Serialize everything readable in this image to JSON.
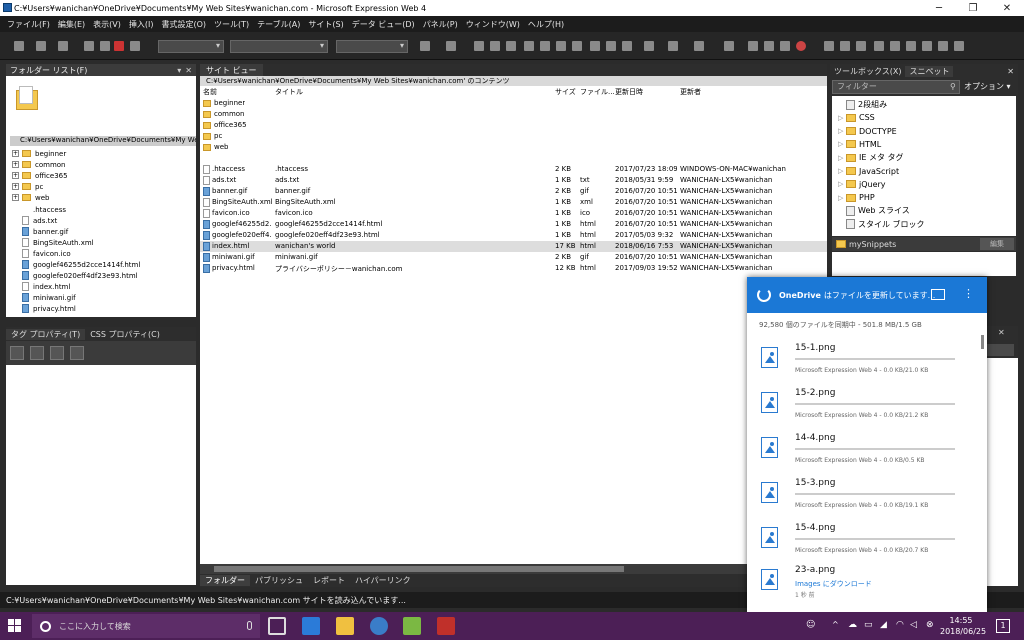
{
  "window": {
    "title": "C:¥Users¥wanichan¥OneDrive¥Documents¥My Web Sites¥wanichan.com - Microsoft Expression Web 4",
    "controls": [
      "─",
      "❐",
      "✕"
    ]
  },
  "menu": [
    "ファイル(F)",
    "編集(E)",
    "表示(V)",
    "挿入(I)",
    "書式設定(O)",
    "ツール(T)",
    "テーブル(A)",
    "サイト(S)",
    "データ ビュー(D)",
    "パネル(P)",
    "ウィンドウ(W)",
    "ヘルプ(H)"
  ],
  "folder_list": {
    "title": "フォルダー リスト(F)",
    "path": "C:¥Users¥wanichan¥OneDrive¥Documents¥My Web S",
    "folders": [
      "beginner",
      "common",
      "office365",
      "pc",
      "web"
    ],
    "files": [
      ".htaccess",
      "ads.txt",
      "banner.gif",
      "BingSiteAuth.xml",
      "favicon.ico",
      "googlef46255d2cce1414f.html",
      "googlefe020eff4df23e93.html",
      "index.html",
      "miniwani.gif",
      "privacy.html"
    ]
  },
  "tag_panel": {
    "tab1": "タグ プロパティ(T)",
    "tab2": "CSS プロパティ(C)"
  },
  "site_view": {
    "tab": "サイト ビュー",
    "path": "C:¥Users¥wanichan¥OneDrive¥Documents¥My Web Sites¥wanichan.com' のコンテンツ",
    "columns": {
      "name": "名前",
      "title": "タイトル",
      "size": "サイズ",
      "type": "ファイル...",
      "modified": "更新日時",
      "author": "更新者"
    },
    "folders": [
      "beginner",
      "common",
      "office365",
      "pc",
      "web"
    ],
    "files": [
      {
        "name": ".htaccess",
        "title": ".htaccess",
        "size": "2 KB",
        "type": "",
        "modified": "2017/07/23 18:09",
        "author": "WINDOWS-ON-MAC¥wanichan"
      },
      {
        "name": "ads.txt",
        "title": "ads.txt",
        "size": "1 KB",
        "type": "txt",
        "modified": "2018/05/31 9:59",
        "author": "WANICHAN-LX5¥wanichan"
      },
      {
        "name": "banner.gif",
        "title": "banner.gif",
        "size": "2 KB",
        "type": "gif",
        "modified": "2016/07/20 10:51",
        "author": "WANICHAN-LX5¥wanichan"
      },
      {
        "name": "BingSiteAuth.xml",
        "title": "BingSiteAuth.xml",
        "size": "1 KB",
        "type": "xml",
        "modified": "2016/07/20 10:51",
        "author": "WANICHAN-LX5¥wanichan"
      },
      {
        "name": "favicon.ico",
        "title": "favicon.ico",
        "size": "1 KB",
        "type": "ico",
        "modified": "2016/07/20 10:51",
        "author": "WANICHAN-LX5¥wanichan"
      },
      {
        "name": "googlef46255d2...",
        "title": "googlef46255d2cce1414f.html",
        "size": "1 KB",
        "type": "html",
        "modified": "2016/07/20 10:51",
        "author": "WANICHAN-LX5¥wanichan"
      },
      {
        "name": "googlefe020eff4...",
        "title": "googlefe020eff4df23e93.html",
        "size": "1 KB",
        "type": "html",
        "modified": "2017/05/03 9:32",
        "author": "WANICHAN-LX5¥wanichan"
      },
      {
        "name": "index.html",
        "title": "wanichan's world",
        "size": "17 KB",
        "type": "html",
        "modified": "2018/06/16 7:53",
        "author": "WANICHAN-LX5¥wanichan"
      },
      {
        "name": "miniwani.gif",
        "title": "miniwani.gif",
        "size": "2 KB",
        "type": "gif",
        "modified": "2016/07/20 10:51",
        "author": "WANICHAN-LX5¥wanichan"
      },
      {
        "name": "privacy.html",
        "title": "プライバシーポリシー－wanichan.com",
        "size": "12 KB",
        "type": "html",
        "modified": "2017/09/03 19:52",
        "author": "WANICHAN-LX5¥wanichan"
      }
    ],
    "bottom_tabs": [
      "フォルダー",
      "パブリッシュ",
      "レポート",
      "ハイパーリンク"
    ]
  },
  "toolbox": {
    "tab1": "ツールボックス(X)",
    "tab2": "スニペット",
    "filter_placeholder": "フィルター",
    "options": "オプション ▾",
    "items": [
      {
        "label": "2段組み",
        "kind": "page"
      },
      {
        "label": "CSS",
        "kind": "folder"
      },
      {
        "label": "DOCTYPE",
        "kind": "folder"
      },
      {
        "label": "HTML",
        "kind": "folder"
      },
      {
        "label": "IE メタ タグ",
        "kind": "folder"
      },
      {
        "label": "JavaScript",
        "kind": "folder"
      },
      {
        "label": "jQuery",
        "kind": "folder"
      },
      {
        "label": "PHP",
        "kind": "folder"
      },
      {
        "label": "Web スライス",
        "kind": "page"
      },
      {
        "label": "スタイル ブロック",
        "kind": "page"
      }
    ],
    "snippets_folder": "mySnippets",
    "edit_button": "編集"
  },
  "status_bar": "C:¥Users¥wanichan¥OneDrive¥Documents¥My Web Sites¥wanichan.com サイトを読み込んでいます...",
  "onedrive": {
    "brand": "OneDrive",
    "message": "はファイルを更新しています...",
    "status": "92,580 個のファイルを同期中 - 501.8 MB/1.5 GB",
    "items": [
      {
        "name": "15-1.png",
        "meta": "Microsoft Expression Web 4 - 0.0 KB/21.0 KB"
      },
      {
        "name": "15-2.png",
        "meta": "Microsoft Expression Web 4 - 0.0 KB/21.2 KB"
      },
      {
        "name": "14-4.png",
        "meta": "Microsoft Expression Web 4 - 0.0 KB/0.5 KB"
      },
      {
        "name": "15-3.png",
        "meta": "Microsoft Expression Web 4 - 0.0 KB/19.1 KB"
      },
      {
        "name": "15-4.png",
        "meta": "Microsoft Expression Web 4 - 0.0 KB/20.7 KB"
      }
    ],
    "last_item": {
      "name": "23-a.png",
      "link": "Images にダウンロード",
      "sub": "1 秒 前"
    }
  },
  "taskbar": {
    "search_placeholder": "ここに入力して検索",
    "time": "14:55",
    "date": "2018/06/25",
    "notification_count": "1"
  }
}
